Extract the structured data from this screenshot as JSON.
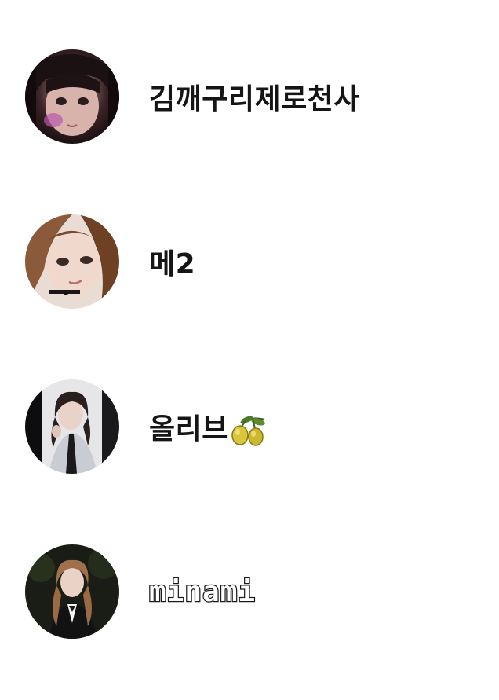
{
  "users": [
    {
      "name": "김깨구리제로천사",
      "avatar_icon": "avatar-photo-icon"
    },
    {
      "name": "메2",
      "avatar_icon": "avatar-photo-icon"
    },
    {
      "name": "올리브",
      "emoji": "olive-icon",
      "avatar_icon": "avatar-photo-icon"
    },
    {
      "name": "minami",
      "avatar_icon": "avatar-photo-icon"
    }
  ],
  "colors": {
    "background": "#ffffff",
    "text": "#151515",
    "olive": "#d4c23a",
    "leaf": "#4f7a2a"
  }
}
